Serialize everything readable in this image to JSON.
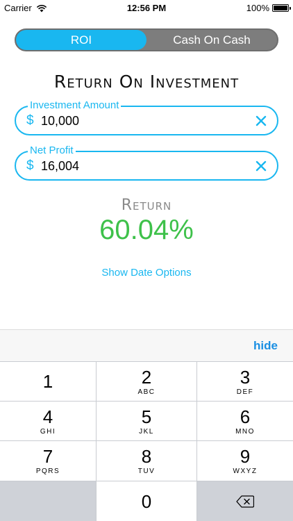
{
  "status_bar": {
    "carrier": "Carrier",
    "time": "12:56 PM",
    "battery": "100%",
    "battery_level": 1.0,
    "wifi_icon": "wifi-icon"
  },
  "segments": [
    {
      "label": "ROI",
      "active": true
    },
    {
      "label": "Cash On Cash",
      "active": false
    }
  ],
  "title": "Return On Investment",
  "fields": {
    "investment": {
      "label": "Investment Amount",
      "currency": "$",
      "value": "10,000",
      "clear_icon": "clear-icon"
    },
    "net_profit": {
      "label": "Net Profit",
      "currency": "$",
      "value": "16,004",
      "clear_icon": "clear-icon"
    }
  },
  "result": {
    "label": "Return",
    "value": "60.04%"
  },
  "date_options_link": "Show Date Options",
  "keyboard": {
    "hide_label": "hide",
    "keys": [
      {
        "num": "1",
        "letters": ""
      },
      {
        "num": "2",
        "letters": "ABC"
      },
      {
        "num": "3",
        "letters": "DEF"
      },
      {
        "num": "4",
        "letters": "GHI"
      },
      {
        "num": "5",
        "letters": "JKL"
      },
      {
        "num": "6",
        "letters": "MNO"
      },
      {
        "num": "7",
        "letters": "PQRS"
      },
      {
        "num": "8",
        "letters": "TUV"
      },
      {
        "num": "9",
        "letters": "WXYZ"
      },
      {
        "num": "0",
        "letters": ""
      }
    ],
    "backspace_icon": "backspace-icon"
  },
  "colors": {
    "accent": "#19b7f0",
    "result_green": "#3ec14a",
    "segment_gray": "#7d7d7d"
  }
}
